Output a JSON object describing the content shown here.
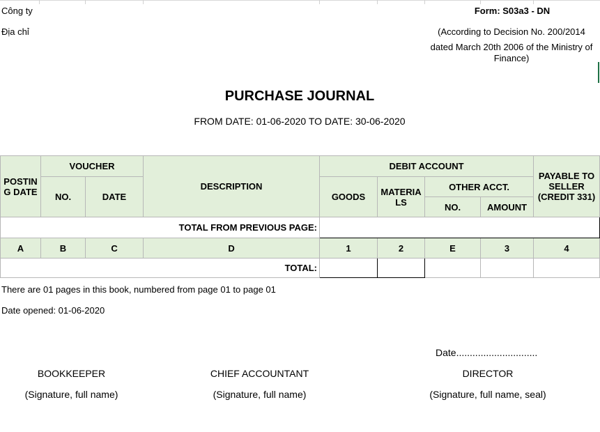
{
  "header": {
    "company_label": "Công ty",
    "address_label": "Địa chỉ",
    "form_code": "Form: S03a3 - DN",
    "decision_line1": "(According to Decision No. 200/2014",
    "decision_line2": "dated March 20th 2006 of the Ministry of",
    "decision_line3": "Finance)"
  },
  "title": "PURCHASE JOURNAL",
  "date_range": "FROM DATE: 01-06-2020 TO DATE: 30-06-2020",
  "table": {
    "posting_date": "POSTIN G DATE",
    "voucher": "VOUCHER",
    "voucher_no": "NO.",
    "voucher_date": "DATE",
    "description": "DESCRIPTION",
    "debit_account": "DEBIT ACCOUNT",
    "goods": "GOODS",
    "materials": "MATERIA LS",
    "other_acct": "OTHER ACCT.",
    "other_no": "NO.",
    "other_amount": "AMOUNT",
    "payable": "PAYABLE TO SELLER (CREDIT 331)",
    "total_previous": "TOTAL FROM PREVIOUS PAGE:",
    "codes": [
      "A",
      "B",
      "C",
      "D",
      "1",
      "2",
      "E",
      "3",
      "4"
    ],
    "total": "TOTAL:"
  },
  "footer": {
    "pages_note": "There are 01 pages in this book, numbered from page 01 to page 01",
    "date_opened": "Date opened:  01-06-2020",
    "date_line": "Date..............................",
    "bookkeeper": "BOOKKEEPER",
    "bookkeeper_sig": "(Signature, full name)",
    "chief_accountant": "CHIEF ACCOUNTANT",
    "chief_sig": "(Signature, full name)",
    "director": "DIRECTOR",
    "director_sig": "(Signature, full name, seal)"
  }
}
